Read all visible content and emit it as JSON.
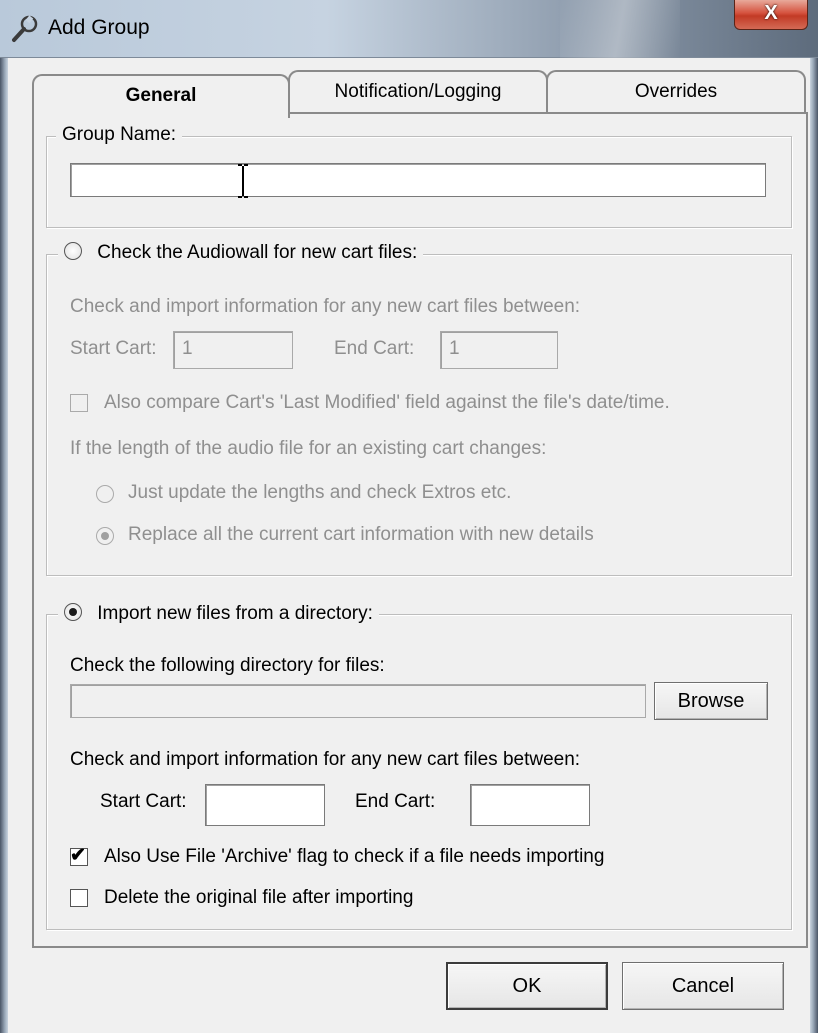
{
  "window": {
    "title": "Add Group",
    "title_icon": "wrench-icon",
    "close_label": "X"
  },
  "tabs": [
    {
      "label": "General",
      "active": true
    },
    {
      "label": "Notification/Logging",
      "active": false
    },
    {
      "label": "Overrides",
      "active": false
    }
  ],
  "group_name": {
    "legend": "Group Name:",
    "value": ""
  },
  "audiowall": {
    "radio_label": "Check the Audiowall for new cart files:",
    "selected": false,
    "enabled": false,
    "between_text": "Check and import information for any new cart files between:",
    "start_cart_label": "Start Cart:",
    "start_cart_value": "1",
    "end_cart_label": "End Cart:",
    "end_cart_value": "1",
    "compare_checkbox_label": "Also compare Cart's 'Last Modified' field against the file's date/time.",
    "compare_checked": false,
    "length_change_text": "If the length of the audio file for an existing cart changes:",
    "option_update_label": "Just update the lengths and check Extros etc.",
    "option_update_selected": false,
    "option_replace_label": "Replace all the current cart information with new details",
    "option_replace_selected": true
  },
  "directory": {
    "radio_label": "Import new files from a directory:",
    "selected": true,
    "check_dir_text": "Check the following directory for files:",
    "directory_value": "",
    "browse_label": "Browse",
    "between_text": "Check and import information for any new cart files between:",
    "start_cart_label": "Start Cart:",
    "start_cart_value": "",
    "end_cart_label": "End Cart:",
    "end_cart_value": "",
    "archive_flag_label": "Also Use File 'Archive' flag to check if a file needs importing",
    "archive_flag_checked": true,
    "delete_original_label": "Delete the original file after importing",
    "delete_original_checked": false
  },
  "footer": {
    "ok_label": "OK",
    "cancel_label": "Cancel"
  }
}
